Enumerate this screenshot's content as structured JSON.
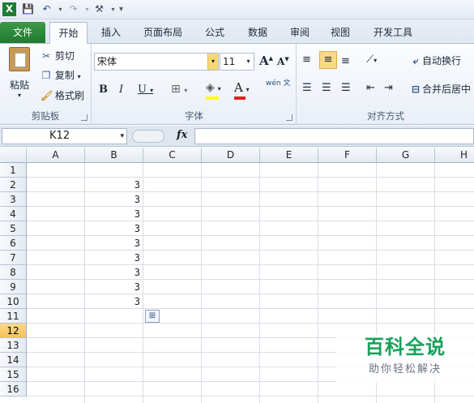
{
  "quick_access": {
    "excel_logo": "X",
    "save_icon": "save-icon",
    "undo_icon": "undo-icon",
    "redo_icon": "redo-icon",
    "customize_icon": "tools-icon"
  },
  "tabs": [
    "文件",
    "开始",
    "插入",
    "页面布局",
    "公式",
    "数据",
    "审阅",
    "视图",
    "开发工具"
  ],
  "active_tab": "开始",
  "ribbon": {
    "clipboard": {
      "label": "剪贴板",
      "paste": "粘贴",
      "cut": "剪切",
      "copy": "复制",
      "format_painter": "格式刷"
    },
    "font": {
      "label": "字体",
      "font_name": "宋体",
      "font_size": "11",
      "grow": "A",
      "shrink": "A",
      "bold": "B",
      "italic": "I",
      "underline": "U",
      "phonetic": "wén 文"
    },
    "alignment": {
      "label": "对齐方式",
      "wrap_text": "自动换行",
      "merge_center": "合并后居中"
    }
  },
  "formula_bar": {
    "name_box": "K12",
    "fx": "fx",
    "formula": ""
  },
  "columns": [
    "A",
    "B",
    "C",
    "D",
    "E",
    "F",
    "G",
    "H"
  ],
  "rows": [
    "1",
    "2",
    "3",
    "4",
    "5",
    "6",
    "7",
    "8",
    "9",
    "10",
    "11",
    "12",
    "13",
    "14",
    "15",
    "16"
  ],
  "selected_row": "12",
  "cells": {
    "B2": "3",
    "B3": "3",
    "B4": "3",
    "B5": "3",
    "B6": "3",
    "B7": "3",
    "B8": "3",
    "B9": "3",
    "B10": "3"
  },
  "watermark": {
    "title": "百科全说",
    "subtitle": "助你轻松解决"
  },
  "colors": {
    "file_tab": "#1f7a2f",
    "selected_row_header": "#f4c15a",
    "watermark": "#18a05a"
  }
}
